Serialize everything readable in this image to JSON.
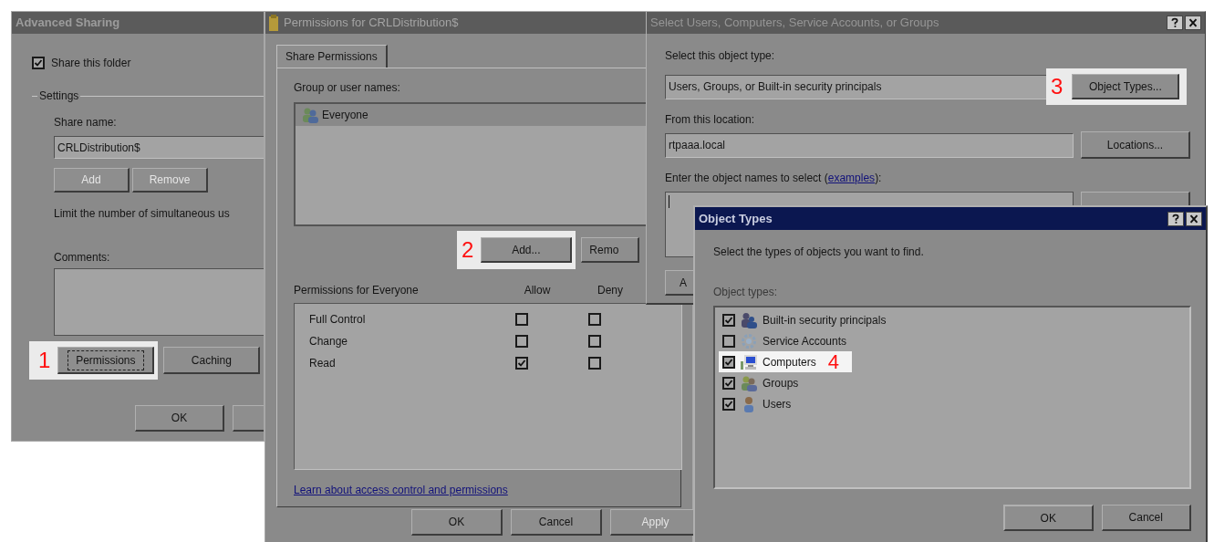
{
  "advanced_sharing": {
    "title": "Advanced Sharing",
    "share_checkbox": {
      "label": "Share this folder",
      "checked": true
    },
    "settings_label": "Settings",
    "share_name_label": "Share name:",
    "share_name_value": "CRLDistribution$",
    "name_buttons": [
      {
        "label": "Add",
        "disabled": true
      },
      {
        "label": "Remove",
        "disabled": true
      }
    ],
    "limit_text": "Limit the number of simultaneous us",
    "comments_label": "Comments:",
    "action_buttons": [
      {
        "label": "Permissions",
        "focused": true,
        "callout": "1"
      },
      {
        "label": "Caching",
        "focused": false
      }
    ],
    "footer_buttons": [
      "OK"
    ]
  },
  "permissions": {
    "title": "Permissions for CRLDistribution$",
    "tabs": [
      {
        "label": "Share Permissions",
        "selected": true
      }
    ],
    "group_label": "Group or user names:",
    "users": [
      {
        "name": "Everyone",
        "selected": true
      }
    ],
    "user_buttons": [
      {
        "label": "Add...",
        "callout": "2"
      },
      {
        "label": "Remo"
      }
    ],
    "permissions_label": "Permissions for Everyone",
    "columns": [
      "Allow",
      "Deny"
    ],
    "rows": [
      {
        "name": "Full Control",
        "allow": false,
        "deny": false
      },
      {
        "name": "Change",
        "allow": false,
        "deny": false
      },
      {
        "name": "Read",
        "allow": true,
        "deny": false
      }
    ],
    "link": "Learn about access control and permissions",
    "footer_buttons": [
      {
        "label": "OK",
        "disabled": false
      },
      {
        "label": "Cancel",
        "disabled": false
      },
      {
        "label": "Apply",
        "disabled": true
      }
    ]
  },
  "select_dialog": {
    "title": "Select Users, Computers, Service Accounts, or Groups",
    "object_type_label": "Select this object type:",
    "object_type_value": "Users, Groups, or Built-in security principals",
    "object_types_button": {
      "label": "Object Types...",
      "callout": "3"
    },
    "location_label": "From this location:",
    "location_value": "rtpaaa.local",
    "locations_button": "Locations...",
    "names_label": "Enter the object names to select (",
    "names_link": "examples",
    "names_label_end": "):",
    "partial_button": "A"
  },
  "object_types": {
    "title": "Object Types",
    "instruction": "Select the types of objects you want to find.",
    "list_label": "Object types:",
    "items": [
      {
        "label": "Built-in security principals",
        "checked": true,
        "kind": "principals"
      },
      {
        "label": "Service Accounts",
        "checked": false,
        "kind": "service"
      },
      {
        "label": "Computers",
        "checked": true,
        "kind": "computer",
        "callout": "4"
      },
      {
        "label": "Groups",
        "checked": true,
        "kind": "group"
      },
      {
        "label": "Users",
        "checked": true,
        "kind": "user"
      }
    ],
    "buttons": [
      "OK",
      "Cancel"
    ]
  }
}
